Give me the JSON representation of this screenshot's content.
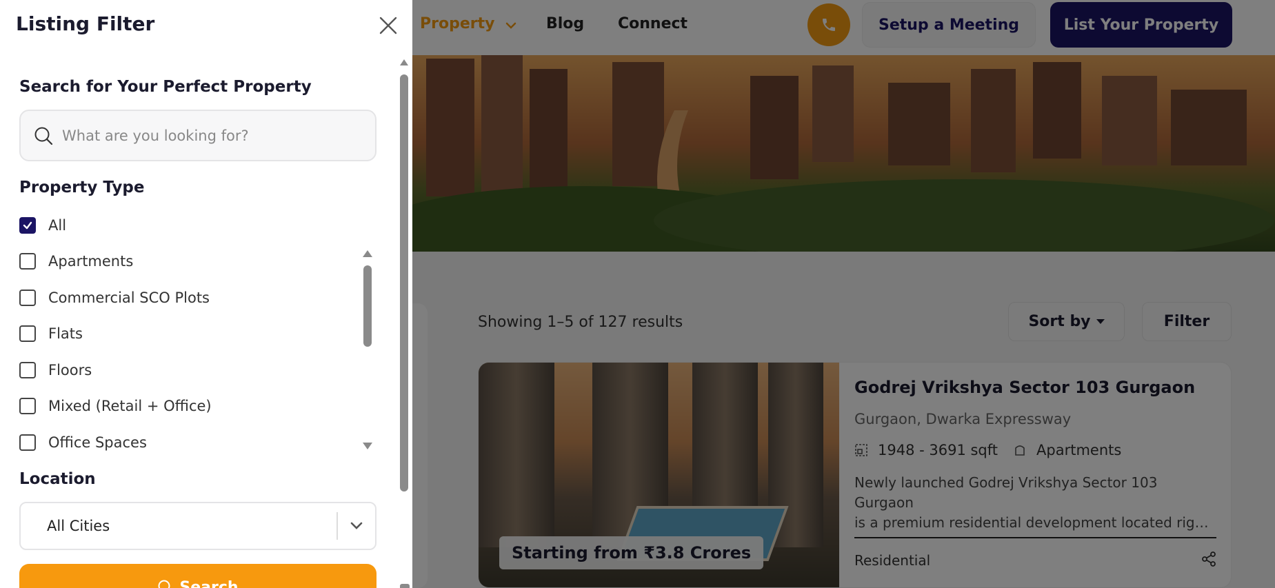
{
  "nav": {
    "property": "Property",
    "blog": "Blog",
    "connect": "Connect",
    "meeting": "Setup a Meeting",
    "list_property": "List Your Property"
  },
  "results": {
    "summary": "Showing 1–5 of 127 results",
    "sort_label": "Sort by",
    "filter_label": "Filter"
  },
  "listing": {
    "title": "Godrej Vrikshya Sector 103 Gurgaon",
    "location": "Gurgaon, Dwarka Expressway",
    "area": "1948 - 3691 sqft",
    "type": "Apartments",
    "desc_line1": "Newly launched Godrej Vrikshya Sector 103 Gurgaon",
    "desc_line2": "is a premium residential development located right at the heart",
    "category": "Residential",
    "price": "Starting from ₹3.8 Crores"
  },
  "drawer": {
    "title": "Listing Filter",
    "search_heading": "Search for Your Perfect Property",
    "search_placeholder": "What are you looking for?",
    "search_value": "",
    "type_heading": "Property Type",
    "types": [
      {
        "label": "All",
        "checked": true
      },
      {
        "label": "Apartments",
        "checked": false
      },
      {
        "label": "Commercial SCO Plots",
        "checked": false
      },
      {
        "label": "Flats",
        "checked": false
      },
      {
        "label": "Floors",
        "checked": false
      },
      {
        "label": "Mixed (Retail + Office)",
        "checked": false
      },
      {
        "label": "Office Spaces",
        "checked": false
      }
    ],
    "location_heading": "Location",
    "city_value": "All Cities",
    "submit_label": "Search"
  },
  "colors": {
    "accent": "#f7990e",
    "brand": "#1b1464"
  }
}
